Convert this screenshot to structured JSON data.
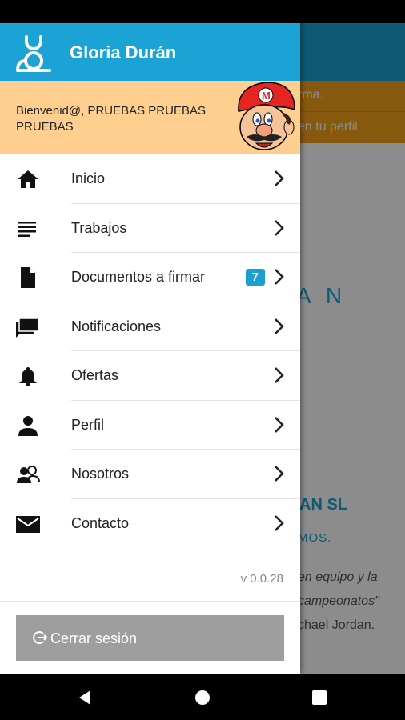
{
  "background": {
    "banner_line1": "rma.",
    "banner_line2": "en tu perfil",
    "big_text": "A N",
    "company": "AN SL",
    "subtitle": "MOS.",
    "quote_line1": "en equipo y la",
    "quote_line2": "campeonatos\"",
    "author": "chael Jordan."
  },
  "drawer": {
    "user_name": "Gloria Durán",
    "welcome": "Bienvenid@, PRUEBAS PRUEBAS PRUEBAS",
    "menu": [
      {
        "label": "Inicio",
        "icon": "home-icon"
      },
      {
        "label": "Trabajos",
        "icon": "list-icon"
      },
      {
        "label": "Documentos a firmar",
        "icon": "document-icon",
        "badge": "7"
      },
      {
        "label": "Notificaciones",
        "icon": "notifications-icon"
      },
      {
        "label": "Ofertas",
        "icon": "bell-icon"
      },
      {
        "label": "Perfil",
        "icon": "person-icon"
      },
      {
        "label": "Nosotros",
        "icon": "group-icon"
      },
      {
        "label": "Contacto",
        "icon": "mail-icon"
      }
    ],
    "version": "v 0.0.28",
    "logout_label": "Cerrar sesión"
  },
  "colors": {
    "primary": "#1aa3d4",
    "welcome_bg": "#ffcf8f",
    "banner": "#f5a21b",
    "logout_bg": "#9e9e9e",
    "badge": "#1a9fd0"
  }
}
